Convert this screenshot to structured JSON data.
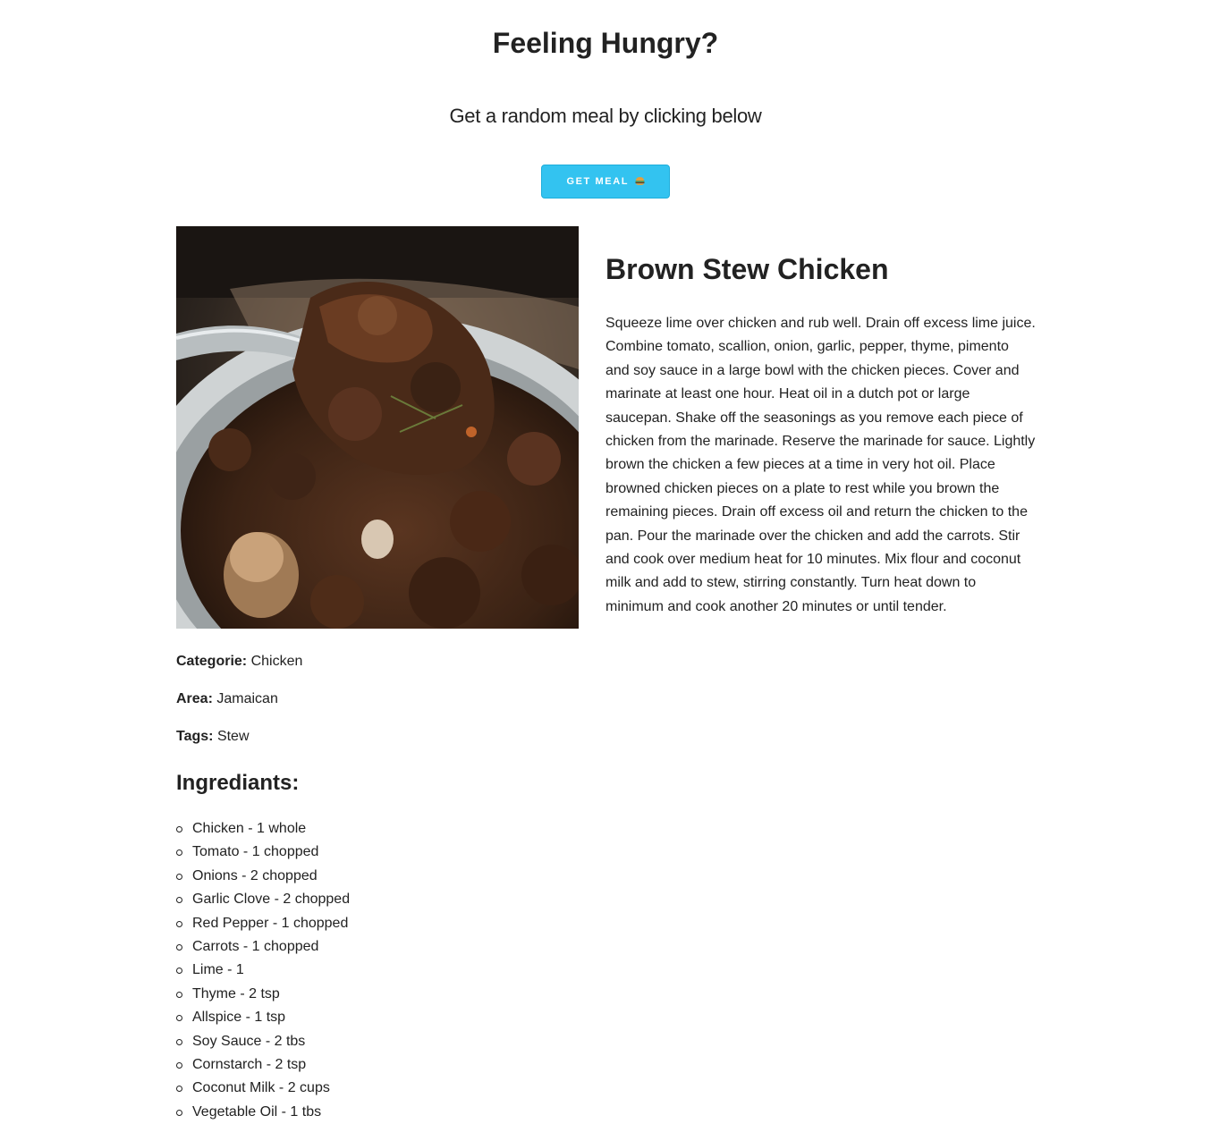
{
  "header": {
    "title": "Feeling Hungry?",
    "subtitle": "Get a random meal by clicking below",
    "button_label": "GET MEAL",
    "button_icon": "burger-icon"
  },
  "colors": {
    "button": "#33c3f0",
    "text": "#222222",
    "background": "#ffffff"
  },
  "meal": {
    "name": "Brown Stew Chicken",
    "instructions": "Squeeze lime over chicken and rub well. Drain off excess lime juice. Combine tomato, scallion, onion, garlic, pepper, thyme, pimento and soy sauce in a large bowl with the chicken pieces. Cover and marinate at least one hour. Heat oil in a dutch pot or large saucepan. Shake off the seasonings as you remove each piece of chicken from the marinade. Reserve the marinade for sauce. Lightly brown the chicken a few pieces at a time in very hot oil. Place browned chicken pieces on a plate to rest while you brown the remaining pieces. Drain off excess oil and return the chicken to the pan. Pour the marinade over the chicken and add the carrots. Stir and cook over medium heat for 10 minutes. Mix flour and coconut milk and add to stew, stirring constantly. Turn heat down to minimum and cook another 20 minutes or until tender.",
    "category_label": "Categorie:",
    "category": "Chicken",
    "area_label": "Area:",
    "area": "Jamaican",
    "tags_label": "Tags:",
    "tags": "Stew",
    "ingredients_title": "Ingrediants:",
    "ingredients": [
      "Chicken - 1 whole",
      "Tomato - 1 chopped",
      "Onions - 2 chopped",
      "Garlic Clove - 2 chopped",
      "Red Pepper - 1 chopped",
      "Carrots - 1 chopped",
      "Lime - 1",
      "Thyme - 2 tsp",
      "Allspice - 1 tsp",
      "Soy Sauce - 2 tbs",
      "Cornstarch - 2 tsp",
      "Coconut Milk - 2 cups",
      "Vegetable Oil - 1 tbs"
    ]
  }
}
